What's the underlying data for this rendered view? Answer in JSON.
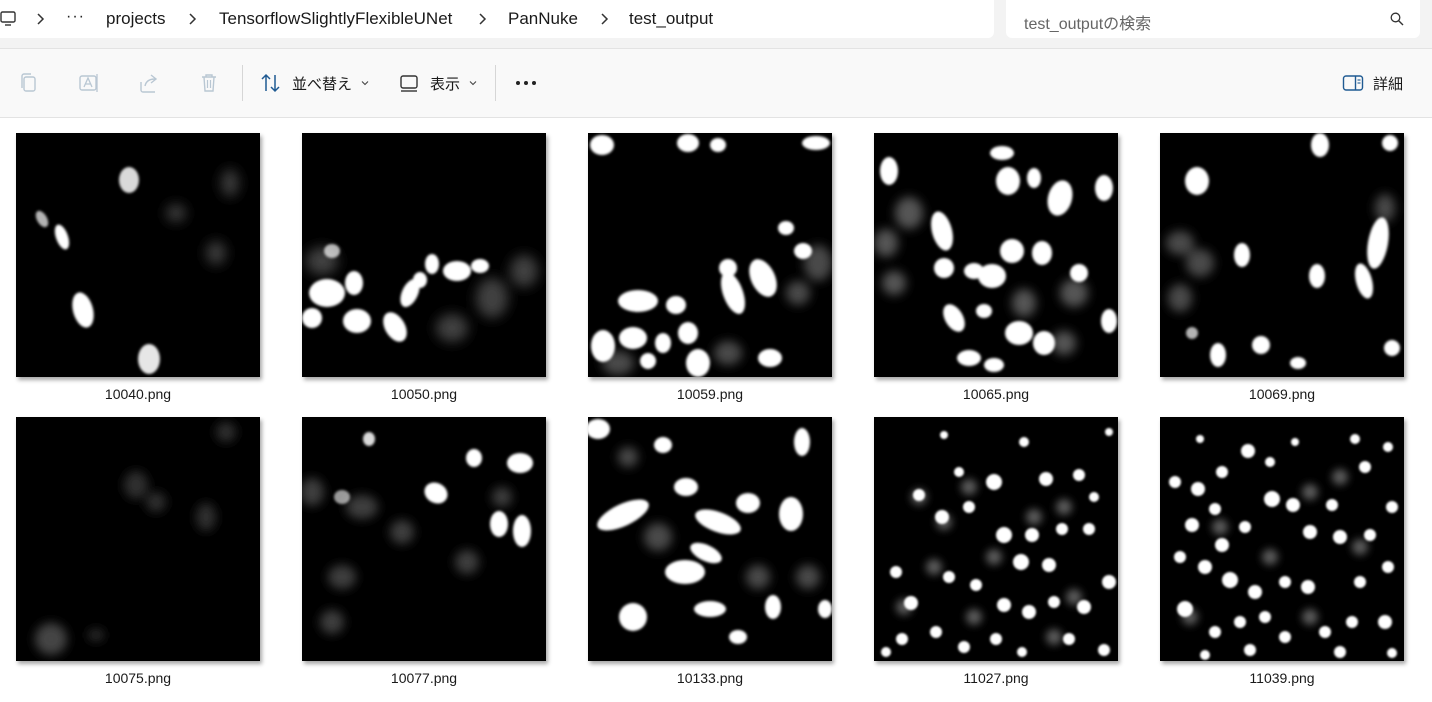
{
  "breadcrumb": {
    "more": "···",
    "items": [
      "projects",
      "TensorflowSlightlyFlexibleUNet",
      "PanNuke",
      "test_output"
    ]
  },
  "search": {
    "placeholder": "test_outputの検索"
  },
  "toolbar": {
    "sort_label": "並べ替え",
    "view_label": "表示",
    "more_label": "•••",
    "details_label": "詳細"
  },
  "files": [
    {
      "name": "10040.png"
    },
    {
      "name": "10050.png"
    },
    {
      "name": "10059.png"
    },
    {
      "name": "10065.png"
    },
    {
      "name": "10069.png"
    },
    {
      "name": "10075.png"
    },
    {
      "name": "10077.png"
    },
    {
      "name": "10133.png"
    },
    {
      "name": "11027.png"
    },
    {
      "name": "11039.png"
    }
  ],
  "colors": {
    "accent": "#0067c0",
    "thumb_bg": "#000000"
  }
}
